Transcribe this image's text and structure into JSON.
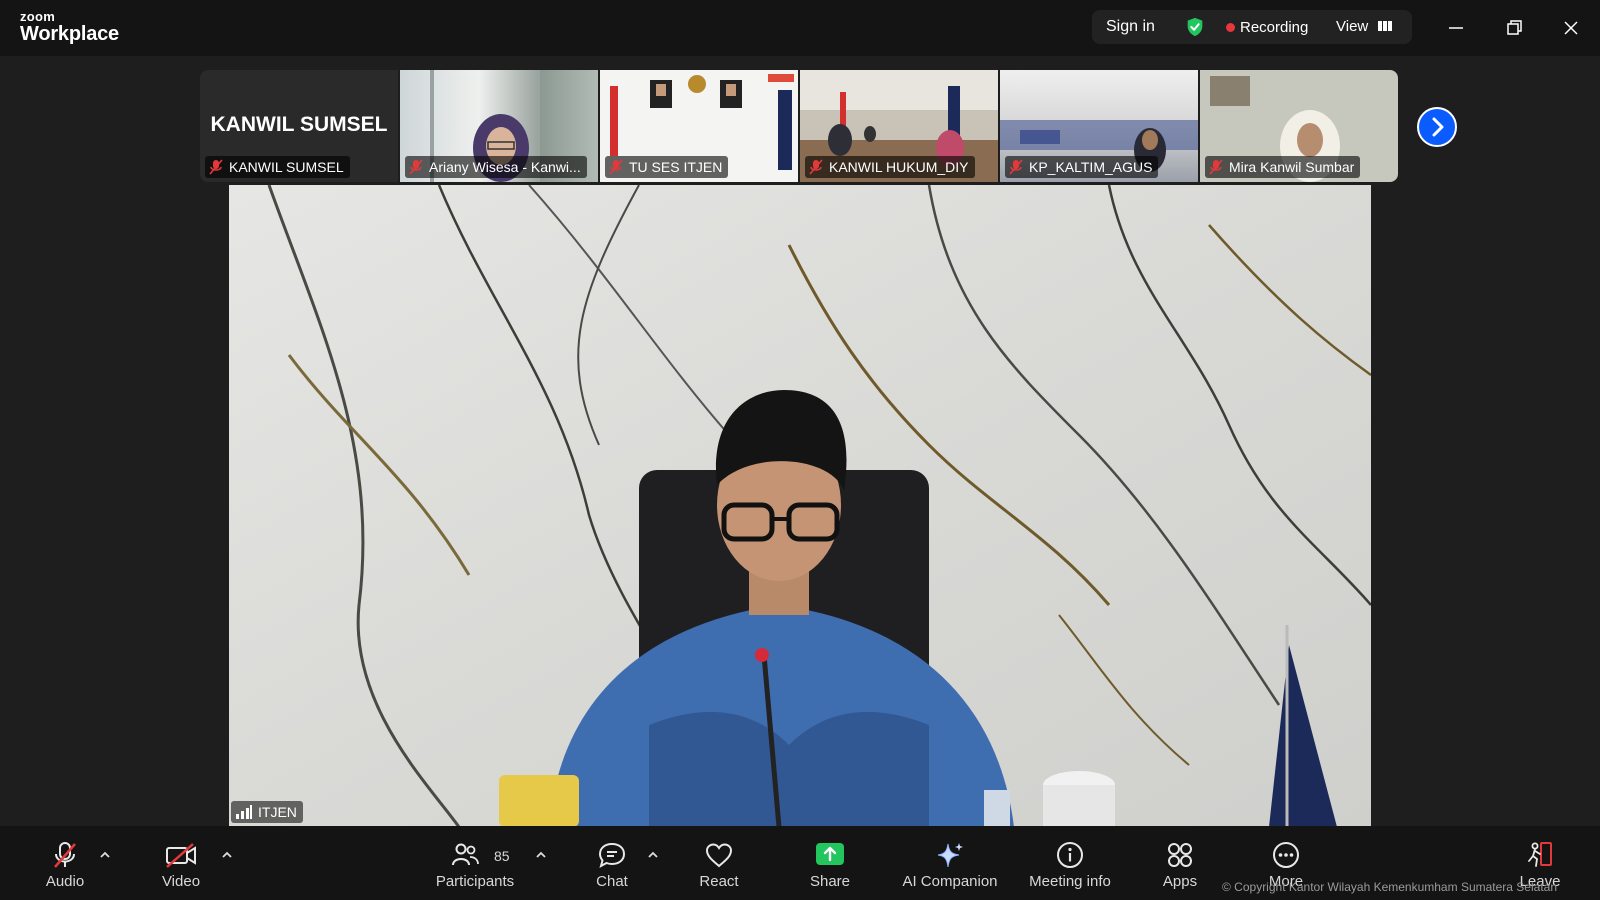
{
  "app": {
    "logo_top": "zoom",
    "logo_bottom": "Workplace"
  },
  "titlebar": {
    "sign_in": "Sign in",
    "recording": "Recording",
    "view": "View",
    "colors": {
      "shield": "#22c55e",
      "recording_dot": "#e5383b"
    }
  },
  "thumbnails": [
    {
      "name": "KANWIL SUMSEL",
      "display_text": "KANWIL SUMSEL",
      "muted": true
    },
    {
      "name": "Ariany Wisesa - Kanwi...",
      "muted": true
    },
    {
      "name": "TU SES ITJEN",
      "muted": true
    },
    {
      "name": "KANWIL HUKUM_DIY",
      "muted": true
    },
    {
      "name": "KP_KALTIM_AGUS",
      "muted": true
    },
    {
      "name": "Mira Kanwil Sumbar",
      "muted": true
    }
  ],
  "main_video": {
    "speaker": "ITJEN"
  },
  "toolbar": {
    "audio": "Audio",
    "video": "Video",
    "participants": "Participants",
    "participants_count": "85",
    "chat": "Chat",
    "react": "React",
    "share": "Share",
    "ai_companion": "AI Companion",
    "meeting_info": "Meeting info",
    "apps": "Apps",
    "more": "More",
    "leave": "Leave",
    "share_color": "#22c55e",
    "leave_color": "#e5383b"
  },
  "watermark": "© Copyright Kantor Wilayah Kemenkumham Sumatera Selatan"
}
